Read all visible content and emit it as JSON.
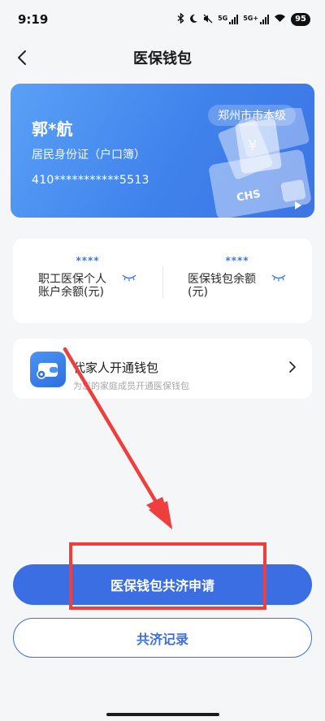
{
  "status_bar": {
    "time": "9:19",
    "network_1": "5G",
    "network_2": "5G+",
    "battery": "95"
  },
  "nav": {
    "title": "医保钱包"
  },
  "card": {
    "name": "郭*航",
    "id_type": "居民身份证（户口簿）",
    "id_number": "410***********5513",
    "region": "郑州市市本级",
    "logo_text": "CHS"
  },
  "balances": [
    {
      "masked_value": "****",
      "label": "职工医保个人账户余额(元)"
    },
    {
      "masked_value": "****",
      "label": "医保钱包余额(元)"
    }
  ],
  "family_wallet": {
    "title": "代家人开通钱包",
    "subtitle": "为您的家庭成员开通医保钱包"
  },
  "buttons": {
    "primary": "医保钱包共济申请",
    "secondary": "共济记录"
  },
  "colors": {
    "accent": "#3b6ee3",
    "card_gradient_start": "#5aa0f6",
    "card_gradient_end": "#3d74e4",
    "annotation": "#ee3e3e"
  }
}
